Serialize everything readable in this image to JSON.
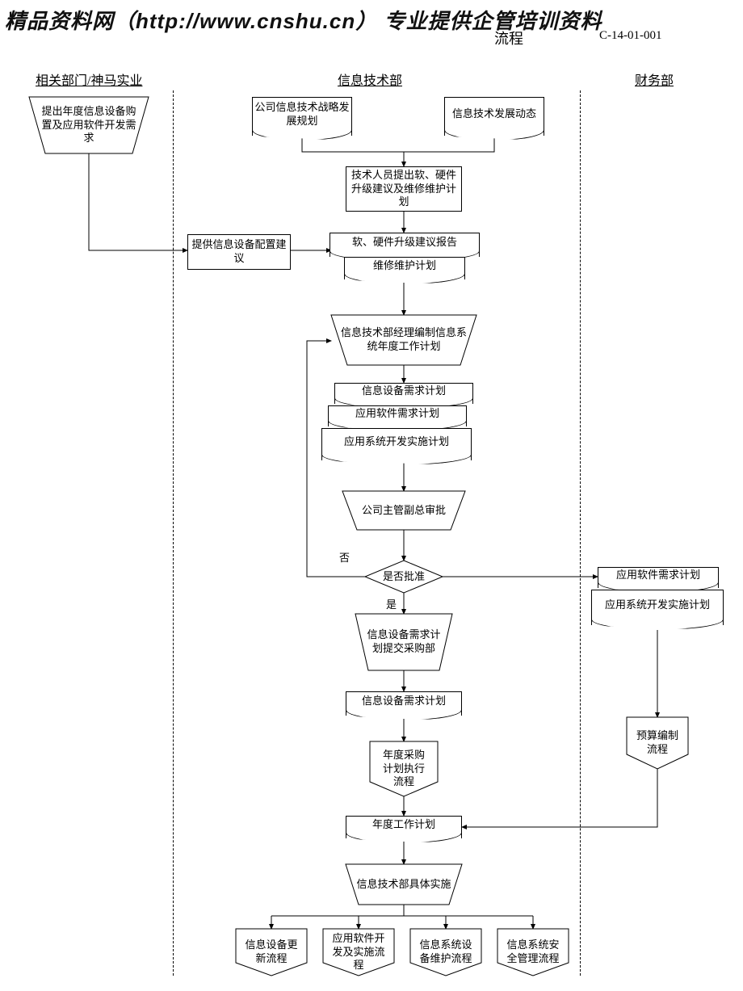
{
  "watermark": "精品资料网（http://www.cnshu.cn） 专业提供企管培训资料",
  "title_fragment": "流程",
  "doc_code": "C-14-01-001",
  "lanes": {
    "left": "相关部门/神马实业",
    "mid": "信息技术部",
    "right": "财务部"
  },
  "nodes": {
    "left_input": "提出年度信息设备购置及应用软件开发需求",
    "strategy": "公司信息技术战略发展规划",
    "trend": "信息技术发展动态",
    "tech_propose": "技术人员提出软、硬件升级建议及维修维护计划",
    "config_advice": "提供信息设备配置建议",
    "upgrade_report": "软、硬件升级建议报告",
    "maint_plan": "维修维护计划",
    "mgr_compile": "信息技术部经理编制信息系统年度工作计划",
    "dev_demand": "信息设备需求计划",
    "sw_demand": "应用软件需求计划",
    "sys_impl_plan": "应用系统开发实施计划",
    "vp_approve": "公司主管副总审批",
    "approved_q": "是否批准",
    "no": "否",
    "yes": "是",
    "submit_purchase": "信息设备需求计划提交采购部",
    "dev_demand2": "信息设备需求计划",
    "annual_purchase": "年度采购计划执行流程",
    "annual_plan": "年度工作计划",
    "implement": "信息技术部具体实施",
    "out1": "信息设备更新流程",
    "out2": "应用软件开发及实施流程",
    "out3": "信息系统设备维护流程",
    "out4": "信息系统安全管理流程",
    "fin_sw": "应用软件需求计划",
    "fin_impl": "应用系统开发实施计划",
    "budget": "预算编制流程"
  }
}
